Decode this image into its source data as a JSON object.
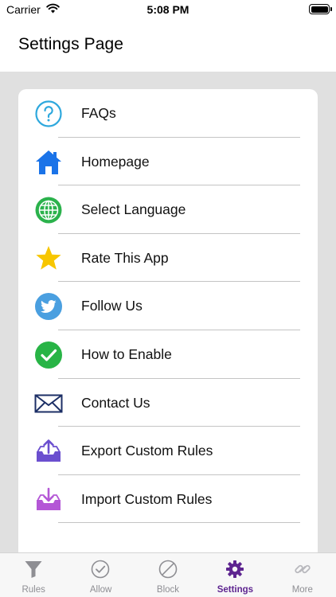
{
  "status_bar": {
    "carrier": "Carrier",
    "time": "5:08 PM"
  },
  "header": {
    "title": "Settings Page"
  },
  "settings": {
    "items": [
      {
        "label": "FAQs",
        "icon": "question-circle-icon"
      },
      {
        "label": "Homepage",
        "icon": "home-icon"
      },
      {
        "label": "Select Language",
        "icon": "globe-icon"
      },
      {
        "label": "Rate This App",
        "icon": "star-icon"
      },
      {
        "label": "Follow Us",
        "icon": "twitter-icon"
      },
      {
        "label": "How to Enable",
        "icon": "checkmark-circle-icon"
      },
      {
        "label": "Contact Us",
        "icon": "envelope-icon"
      },
      {
        "label": "Export Custom Rules",
        "icon": "export-tray-icon"
      },
      {
        "label": "Import Custom Rules",
        "icon": "import-tray-icon"
      }
    ]
  },
  "tab_bar": {
    "active": "Settings",
    "tabs": [
      {
        "label": "Rules",
        "icon": "funnel-icon"
      },
      {
        "label": "Allow",
        "icon": "checkmark-circle-outline-icon"
      },
      {
        "label": "Block",
        "icon": "block-icon"
      },
      {
        "label": "Settings",
        "icon": "gear-icon"
      },
      {
        "label": "More",
        "icon": "link-icon"
      }
    ]
  },
  "colors": {
    "accent": "#5e2590",
    "tab_inactive": "#8e8e93",
    "background": "#e0e0e0",
    "faq_blue": "#2ea8dd",
    "home_blue": "#1a73e8",
    "globe_green": "#2bb24c",
    "star_yellow": "#f7c600",
    "twitter_blue": "#4a9fe0",
    "check_green": "#28b446",
    "envelope_navy": "#1c2f66",
    "export_purple": "#6b4fcf",
    "import_purple": "#b457d6"
  }
}
